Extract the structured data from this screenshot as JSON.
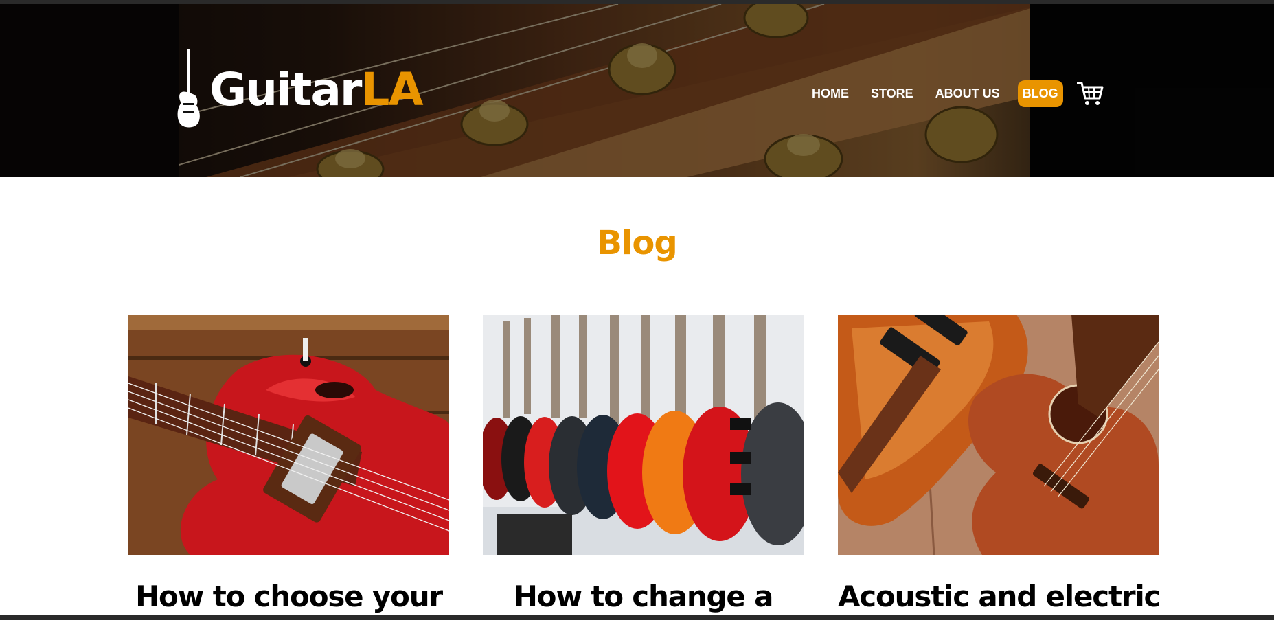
{
  "header": {
    "logo": {
      "brand_main": "Guitar",
      "brand_accent": "LA"
    },
    "nav": [
      {
        "label": "HOME"
      },
      {
        "label": "STORE"
      },
      {
        "label": "ABOUT US"
      },
      {
        "label": "BLOG",
        "active": true
      }
    ],
    "cart_icon": "cart-icon"
  },
  "main": {
    "title": "Blog",
    "posts": [
      {
        "title": "How to choose your",
        "image": "red-semi-hollow-guitar"
      },
      {
        "title": "How to change a",
        "image": "guitar-store-row"
      },
      {
        "title": "Acoustic and electric",
        "image": "bass-and-acoustic-guitar"
      }
    ]
  },
  "colors": {
    "accent": "#e99400",
    "header_dark": "#120c09",
    "text": "#000000"
  }
}
